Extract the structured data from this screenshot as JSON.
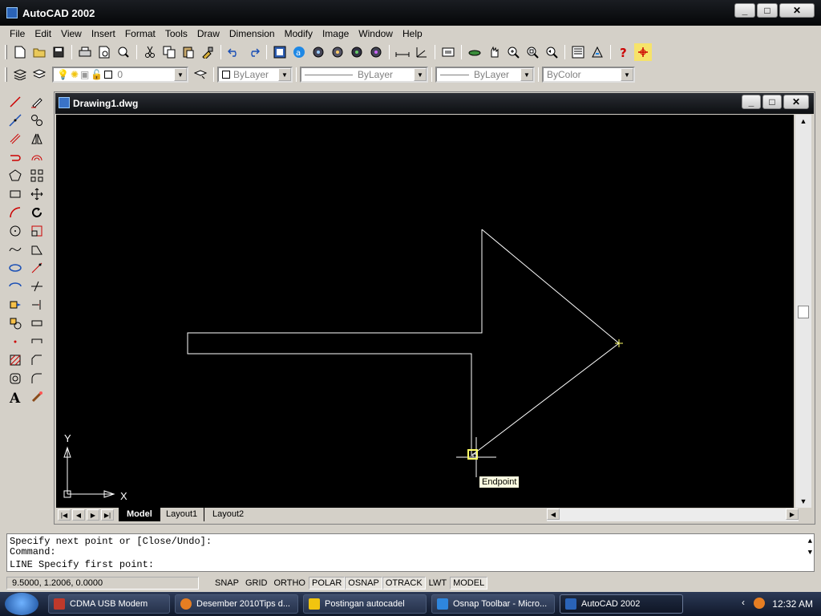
{
  "window": {
    "title": "AutoCAD 2002",
    "btn_min": "_",
    "btn_max": "□",
    "btn_close": "✕"
  },
  "menu": [
    "File",
    "Edit",
    "View",
    "Insert",
    "Format",
    "Tools",
    "Draw",
    "Dimension",
    "Modify",
    "Image",
    "Window",
    "Help"
  ],
  "properties_bar": {
    "layer": "0",
    "color": "ByLayer",
    "linetype": "ByLayer",
    "lineweight": "ByLayer",
    "plotstyle": "ByColor"
  },
  "drawing_window": {
    "title": "Drawing1.dwg",
    "tooltip": "Endpoint",
    "ucs_x_label": "X",
    "ucs_y_label": "Y"
  },
  "layout_tabs": [
    "Model",
    "Layout1",
    "Layout2"
  ],
  "command_lines": [
    "Specify next point or [Close/Undo]:",
    "Command:",
    "LINE Specify first point:"
  ],
  "status": {
    "coordinates": "9.5000, 1.2006, 0.0000",
    "buttons": [
      {
        "label": "SNAP",
        "on": false
      },
      {
        "label": "GRID",
        "on": false
      },
      {
        "label": "ORTHO",
        "on": false
      },
      {
        "label": "POLAR",
        "on": true
      },
      {
        "label": "OSNAP",
        "on": true
      },
      {
        "label": "OTRACK",
        "on": true
      },
      {
        "label": "LWT",
        "on": false
      },
      {
        "label": "MODEL",
        "on": true
      }
    ]
  },
  "taskbar": {
    "tasks": [
      {
        "label": "CDMA USB Modem",
        "color": "#c0392b"
      },
      {
        "label": "Desember 2010Tips d...",
        "color": "#e67e22"
      },
      {
        "label": "Postingan autocadel",
        "color": "#f1c40f"
      },
      {
        "label": "Osnap Toolbar - Micro...",
        "color": "#2e86de"
      },
      {
        "label": "AutoCAD 2002",
        "color": "#2a63b7"
      }
    ],
    "clock": "12:32 AM"
  },
  "colors": {
    "canvas": "#000000",
    "geometry": "#ffffff",
    "marker": "#ffff66"
  }
}
